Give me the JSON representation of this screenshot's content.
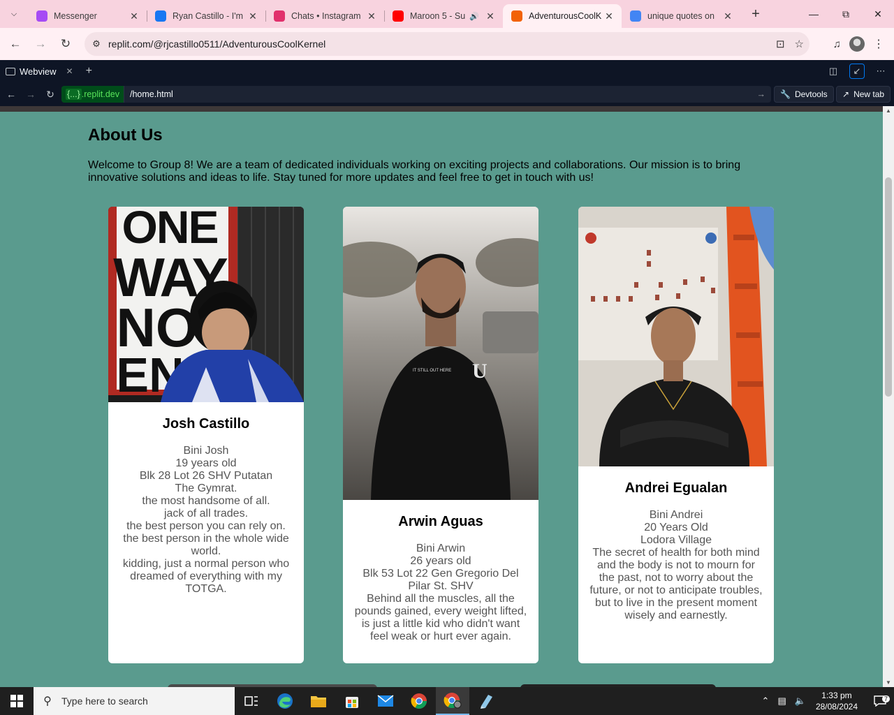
{
  "browser": {
    "tabs": [
      {
        "title": "Messenger",
        "icon": "messenger-icon",
        "color": "#a64bf4",
        "active": false
      },
      {
        "title": "Ryan Castillo - I'm",
        "icon": "facebook-icon",
        "color": "#1877f2",
        "active": false
      },
      {
        "title": "Chats • Instagram",
        "icon": "instagram-icon",
        "color": "#e1306c",
        "active": false
      },
      {
        "title": "Maroon 5 - Su",
        "icon": "youtube-icon",
        "color": "#ff0000",
        "active": false,
        "audio": true
      },
      {
        "title": "AdventurousCoolK",
        "icon": "replit-icon",
        "color": "#f26207",
        "active": true
      },
      {
        "title": "unique quotes on",
        "icon": "google-icon",
        "color": "#4285f4",
        "active": false
      }
    ],
    "url": "replit.com/@rjcastillo0511/AdventurousCoolKernel"
  },
  "webview": {
    "tab_label": "Webview",
    "domain_prefix": "{...}",
    "domain": ".replit.dev",
    "path": "/home.html",
    "devtools_label": "Devtools",
    "newtab_label": "New tab"
  },
  "page": {
    "title": "About Us",
    "intro": "Welcome to Group 8! We are a team of dedicated individuals working on exciting projects and collaborations. Our mission is to bring innovative solutions and ideas to life. Stay tuned for more updates and feel free to get in touch with us!",
    "members": [
      {
        "name": "Josh Castillo",
        "lines": [
          "Bini Josh",
          "19 years old",
          "Blk 28 Lot 26 SHV Putatan",
          "The Gymrat.",
          "the most handsome of all.",
          "jack of all trades.",
          "the best person you can rely on.",
          "the best person in the whole wide world.",
          "kidding, just a normal person who dreamed of everything with my TOTGA."
        ],
        "photo_sign_text": "ONE WAY NO EN"
      },
      {
        "name": "Arwin Aguas",
        "lines": [
          "Bini Arwin",
          "26 years old",
          "Blk 53 Lot 22 Gen Gregorio Del Pilar St. SHV",
          "Behind all the muscles, all the pounds gained, every weight lifted, is just a little kid who didn't want feel weak or hurt ever again."
        ]
      },
      {
        "name": "Andrei Egualan",
        "lines": [
          "Bini Andrei",
          "20 Years Old",
          "Lodora Village",
          "The secret of health for both mind and the body is not to mourn for the past, not to worry about the future, or not to anticipate troubles, but to live in the present moment wisely and earnestly."
        ]
      }
    ]
  },
  "taskbar": {
    "search_placeholder": "Type here to search",
    "time": "1:33 pm",
    "date": "28/08/2024",
    "notifications": "7"
  },
  "colors": {
    "page_bg": "#5a9b8e",
    "tabstrip_bg": "#f8d3df",
    "replit_bg": "#0e1525"
  }
}
